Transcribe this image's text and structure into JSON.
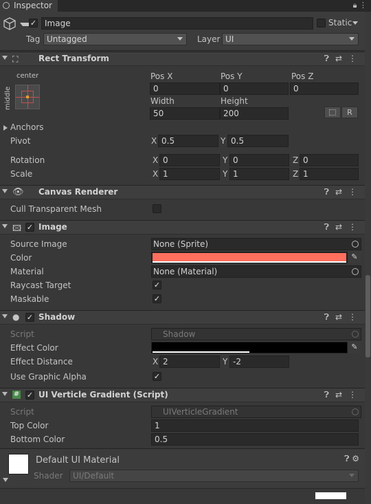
{
  "tab": {
    "label": "Inspector"
  },
  "header": {
    "active_checked": "✓",
    "object_name": "Image",
    "static_label": "Static",
    "tag_label": "Tag",
    "tag_value": "Untagged",
    "layer_label": "Layer",
    "layer_value": "UI"
  },
  "rect_transform": {
    "title": "Rect Transform",
    "anchor_h": "center",
    "anchor_v": "middle",
    "pos_x_label": "Pos X",
    "pos_x": "0",
    "pos_y_label": "Pos Y",
    "pos_y": "0",
    "pos_z_label": "Pos Z",
    "pos_z": "0",
    "width_label": "Width",
    "width": "50",
    "height_label": "Height",
    "height": "200",
    "raw_button": "R",
    "anchors_label": "Anchors",
    "pivot_label": "Pivot",
    "pivot_x": "0.5",
    "pivot_y": "0.5",
    "rotation_label": "Rotation",
    "rot_x": "0",
    "rot_y": "0",
    "rot_z": "0",
    "scale_label": "Scale",
    "scale_x": "1",
    "scale_y": "1",
    "scale_z": "1",
    "x": "X",
    "y": "Y",
    "z": "Z"
  },
  "canvas_renderer": {
    "title": "Canvas Renderer",
    "cull_label": "Cull Transparent Mesh"
  },
  "image": {
    "title": "Image",
    "enabled": "✓",
    "source_image_label": "Source Image",
    "source_image": "None (Sprite)",
    "color_label": "Color",
    "color": "#ff6f5e",
    "material_label": "Material",
    "material": "None (Material)",
    "raycast_label": "Raycast Target",
    "raycast": "✓",
    "maskable_label": "Maskable",
    "maskable": "✓"
  },
  "shadow": {
    "title": "Shadow",
    "enabled": "✓",
    "script_label": "Script",
    "script": "Shadow",
    "effect_color_label": "Effect Color",
    "effect_distance_label": "Effect Distance",
    "dist_x": "2",
    "dist_y": "-2",
    "use_alpha_label": "Use Graphic Alpha",
    "use_alpha": "✓"
  },
  "gradient": {
    "title": "UI Verticle Gradient (Script)",
    "enabled": "✓",
    "script_label": "Script",
    "script": "UIVerticleGradient",
    "top_color_label": "Top Color",
    "top_color": "1",
    "bottom_color_label": "Bottom Color",
    "bottom_color": "0.5"
  },
  "material_preview": {
    "name": "Default UI Material",
    "shader_label": "Shader",
    "shader_value": "UI/Default"
  }
}
